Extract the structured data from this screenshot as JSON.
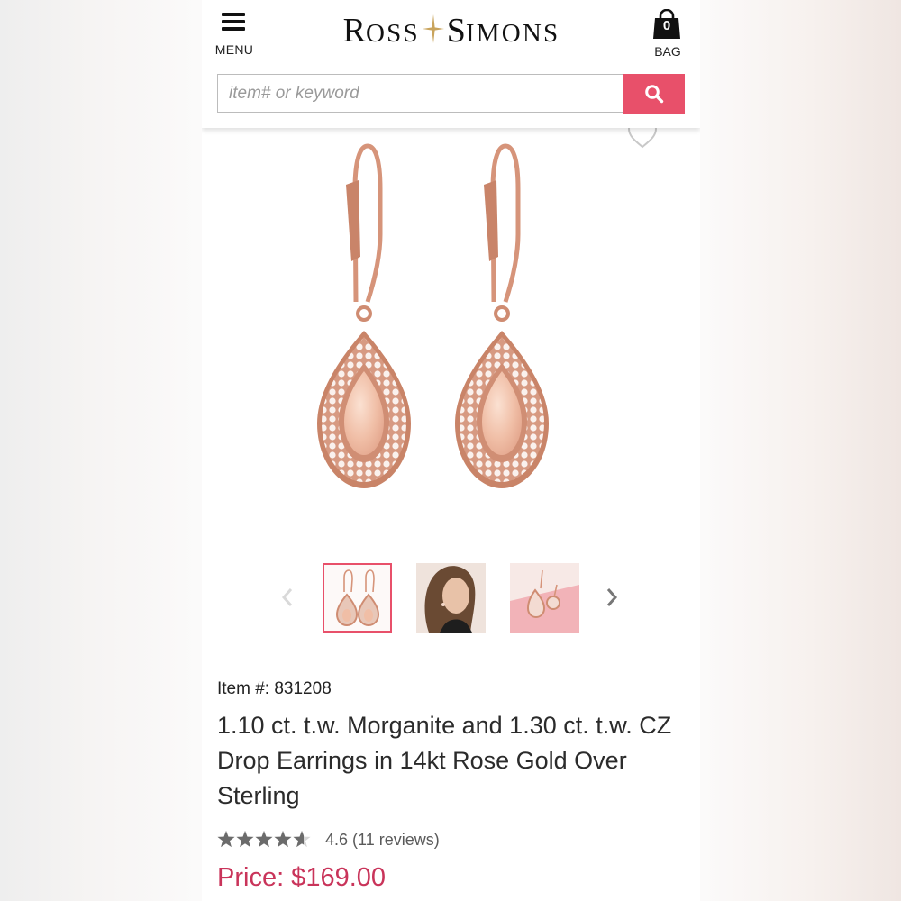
{
  "header": {
    "menu_label": "MENU",
    "logo_left": {
      "initial": "R",
      "rest": "OSS"
    },
    "logo_right": {
      "initial": "S",
      "rest": "IMONS"
    },
    "bag_count": "0",
    "bag_label": "BAG",
    "search_placeholder": "item# or keyword"
  },
  "colors": {
    "accent": "#e8506a",
    "price": "#c9345a",
    "logo_star": "#c9a45c",
    "rose_gold": "#d99a80",
    "morganite": "#f2c2aa"
  },
  "product": {
    "item_number": "Item #: 831208",
    "title": "1.10 ct. t.w. Morganite and 1.30 ct. t.w. CZ Drop Earrings in 14kt Rose Gold Over Sterling",
    "rating_value": 4.6,
    "rating_max": 5,
    "rating_text": "4.6 (11 reviews)",
    "price": "Price: $169.00"
  },
  "gallery": {
    "thumbnails": [
      {
        "subject": "earrings-product",
        "selected": true
      },
      {
        "subject": "model-wearing-earrings",
        "selected": false
      },
      {
        "subject": "earrings-on-pink-background",
        "selected": false
      }
    ]
  },
  "icons": [
    "menu-icon",
    "bag-icon",
    "search-icon",
    "heart-icon",
    "chevron-left-icon",
    "chevron-right-icon",
    "star-icon",
    "logo-star-icon"
  ]
}
